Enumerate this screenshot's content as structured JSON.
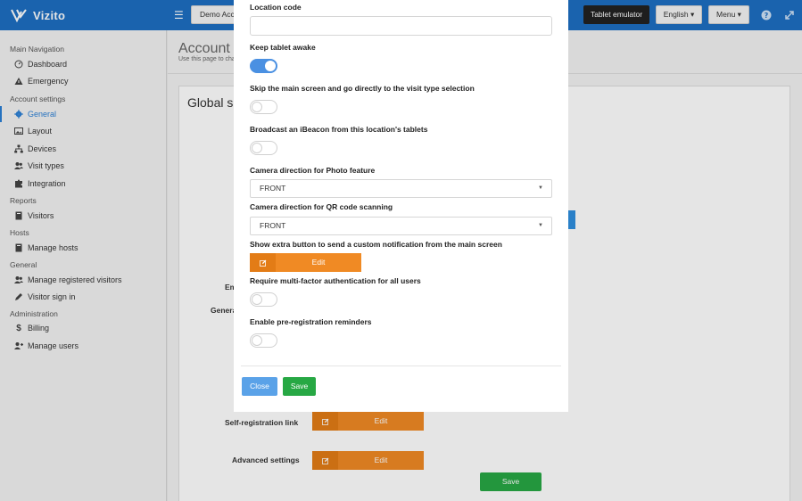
{
  "header": {
    "brand_name": "Vizito",
    "location_button": "Demo Acco",
    "tablet_emulator": "Tablet emulator",
    "language": "English ▾",
    "menu": "Menu ▾"
  },
  "sidebar": {
    "sections": [
      {
        "title": "Main Navigation",
        "items": [
          {
            "label": "Dashboard",
            "icon": "dashboard-icon"
          },
          {
            "label": "Emergency",
            "icon": "warning-icon"
          }
        ]
      },
      {
        "title": "Account settings",
        "items": [
          {
            "label": "General",
            "icon": "gear-icon",
            "active": true
          },
          {
            "label": "Layout",
            "icon": "image-icon"
          },
          {
            "label": "Devices",
            "icon": "sitemap-icon"
          },
          {
            "label": "Visit types",
            "icon": "users-icon"
          },
          {
            "label": "Integration",
            "icon": "puzzle-icon"
          }
        ]
      },
      {
        "title": "Reports",
        "items": [
          {
            "label": "Visitors",
            "icon": "book-icon"
          }
        ]
      },
      {
        "title": "Hosts",
        "items": [
          {
            "label": "Manage hosts",
            "icon": "book-icon"
          }
        ]
      },
      {
        "title": "General",
        "items": [
          {
            "label": "Manage registered visitors",
            "icon": "users-icon"
          },
          {
            "label": "Visitor sign in",
            "icon": "pencil-icon"
          }
        ]
      },
      {
        "title": "Administration",
        "items": [
          {
            "label": "Billing",
            "icon": "dollar-icon"
          },
          {
            "label": "Manage users",
            "icon": "user-plus-icon"
          }
        ]
      }
    ]
  },
  "main": {
    "title": "Account",
    "subtitle": "Use this page to cha",
    "panel_title": "Global se",
    "labels": {
      "email": "Em",
      "general": "Genera",
      "self_registration": "Self-registration link",
      "advanced": "Advanced settings"
    },
    "edit_label": "Edit",
    "save_label": "Save"
  },
  "modal": {
    "location_code_label": "Location code",
    "location_code_value": "",
    "keep_awake_label": "Keep tablet awake",
    "keep_awake_on": true,
    "skip_main_label": "Skip the main screen and go directly to the visit type selection",
    "skip_main_on": false,
    "ibeacon_label": "Broadcast an iBeacon from this location's tablets",
    "ibeacon_on": false,
    "camera_photo_label": "Camera direction for Photo feature",
    "camera_photo_value": "FRONT",
    "camera_qr_label": "Camera direction for QR code scanning",
    "camera_qr_value": "FRONT",
    "extra_button_label": "Show extra button to send a custom notification from the main screen",
    "edit_label": "Edit",
    "mfa_label": "Require multi-factor authentication for all users",
    "mfa_on": false,
    "prereg_label": "Enable pre-registration reminders",
    "prereg_on": false,
    "close_label": "Close",
    "save_label": "Save"
  },
  "colors": {
    "topbar": "#1e6fc2",
    "accent": "#2b7fd5",
    "edit_orange": "#f08a24",
    "save_green": "#27a844",
    "toggle_on": "#4a90e2"
  }
}
